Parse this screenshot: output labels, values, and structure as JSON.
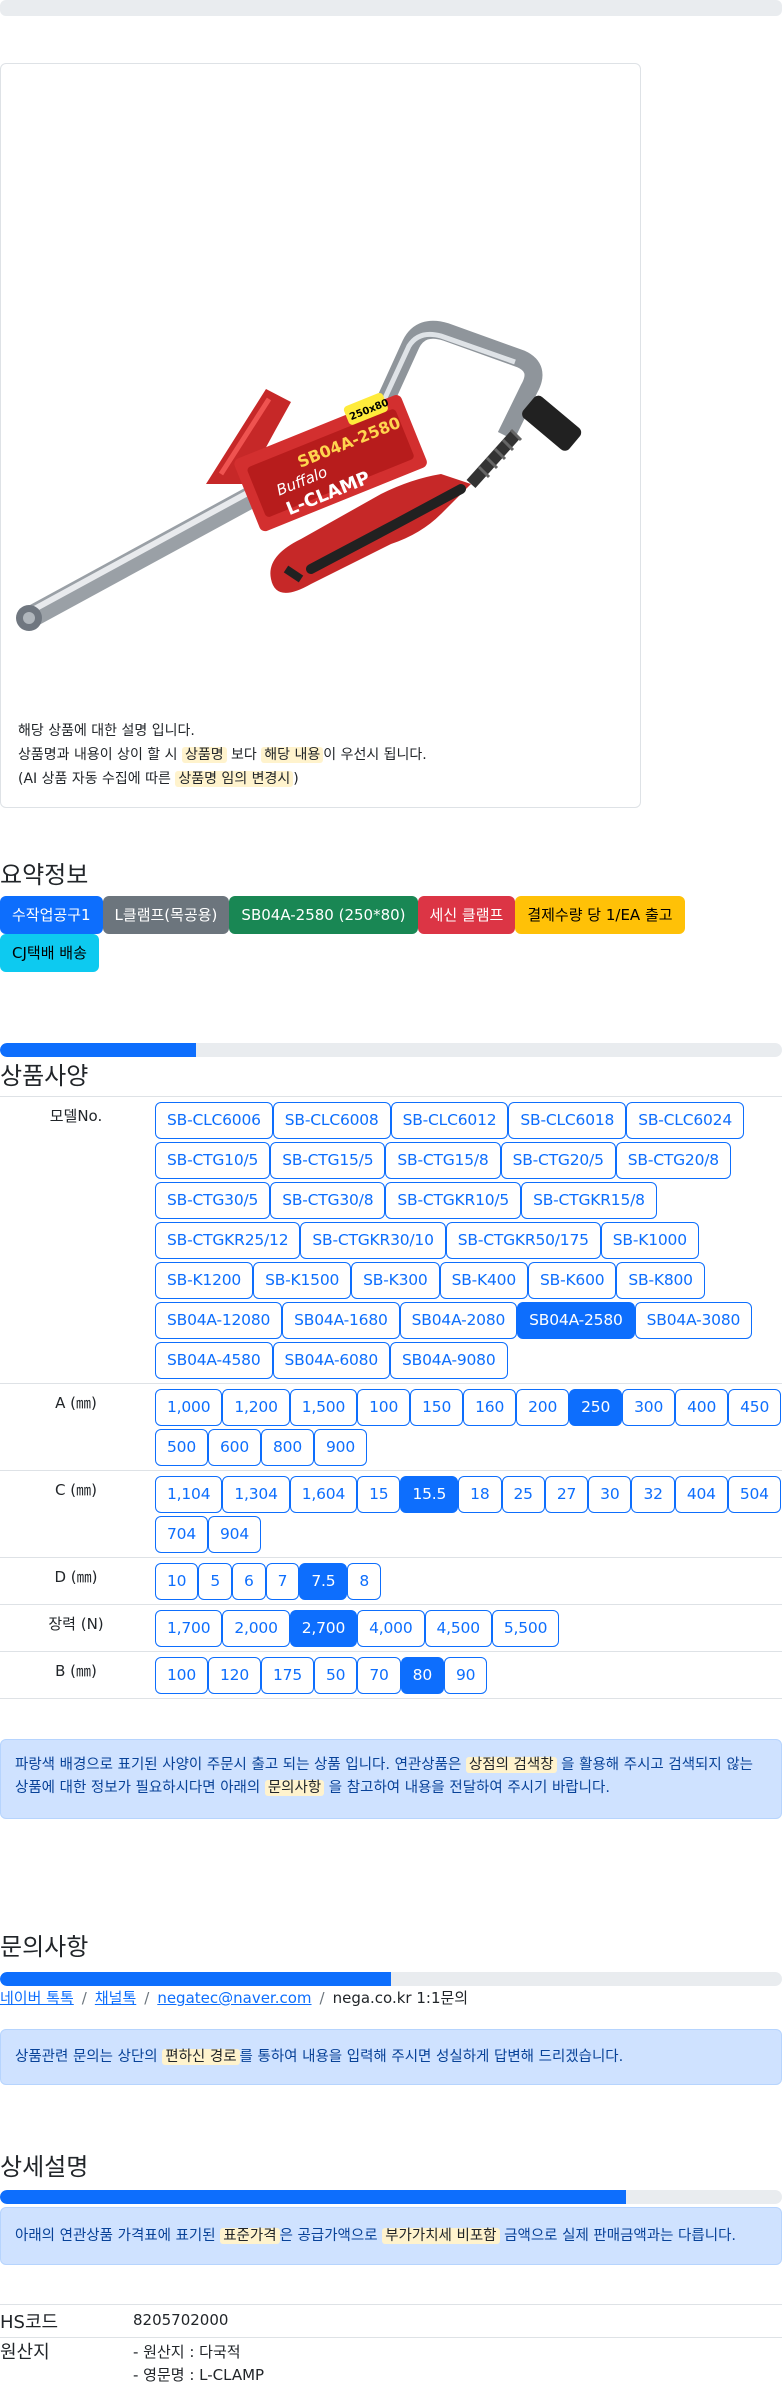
{
  "product": {
    "image_alt": "SB04A-2580 Buffalo L-CLAMP",
    "desc": {
      "line1": "해당 상품에 대한 설명 입니다.",
      "line2_a": "상품명과 내용이 상이 할 시 ",
      "line2_hl1": "상품명",
      "line2_b": " 보다 ",
      "line2_hl2": "해당 내용",
      "line2_c": "이 우선시 됩니다.",
      "line3_a": "(AI 상품 자동 수집에 따른 ",
      "line3_hl": "상품명 임의 변경시",
      "line3_b": ")"
    },
    "package_text": {
      "brand": "Buffalo",
      "model": "SB04A-2580",
      "name": "L-CLAMP",
      "size": "250x80"
    }
  },
  "summary": {
    "title": "요약정보",
    "badges": [
      {
        "label": "수작업공구1",
        "style": "b-primary"
      },
      {
        "label": "L클램프(목공용)",
        "style": "b-secondary"
      },
      {
        "label": "SB04A-2580 (250*80)",
        "style": "b-success"
      },
      {
        "label": "세신 클램프",
        "style": "b-danger"
      },
      {
        "label": "결제수량 당 1/EA 출고",
        "style": "b-warning"
      },
      {
        "label": "CJ택배 배송",
        "style": "b-info"
      }
    ]
  },
  "specs": {
    "title": "상품사양",
    "progress_fraction": 0.25,
    "rows": [
      {
        "label": "모델No.",
        "options": [
          "SB-CLC6006",
          "SB-CLC6008",
          "SB-CLC6012",
          "SB-CLC6018",
          "SB-CLC6024",
          "SB-CTG10/5",
          "SB-CTG15/5",
          "SB-CTG15/8",
          "SB-CTG20/5",
          "SB-CTG20/8",
          "SB-CTG30/5",
          "SB-CTG30/8",
          "SB-CTGKR10/5",
          "SB-CTGKR15/8",
          "SB-CTGKR25/12",
          "SB-CTGKR30/10",
          "SB-CTGKR50/175",
          "SB-K1000",
          "SB-K1200",
          "SB-K1500",
          "SB-K300",
          "SB-K400",
          "SB-K600",
          "SB-K800",
          "SB04A-12080",
          "SB04A-1680",
          "SB04A-2080",
          "SB04A-2580",
          "SB04A-3080",
          "SB04A-4580",
          "SB04A-6080",
          "SB04A-9080"
        ],
        "selected": "SB04A-2580"
      },
      {
        "label": "A (㎜)",
        "options": [
          "1,000",
          "1,200",
          "1,500",
          "100",
          "150",
          "160",
          "200",
          "250",
          "300",
          "400",
          "450",
          "500",
          "600",
          "800",
          "900"
        ],
        "selected": "250"
      },
      {
        "label": "C (㎜)",
        "options": [
          "1,104",
          "1,304",
          "1,604",
          "15",
          "15.5",
          "18",
          "25",
          "27",
          "30",
          "32",
          "404",
          "504",
          "704",
          "904"
        ],
        "selected": "15.5"
      },
      {
        "label": "D (㎜)",
        "options": [
          "10",
          "5",
          "6",
          "7",
          "7.5",
          "8"
        ],
        "selected": "7.5"
      },
      {
        "label": "장력 (N)",
        "options": [
          "1,700",
          "2,000",
          "2,700",
          "4,000",
          "4,500",
          "5,500"
        ],
        "selected": "2,700"
      },
      {
        "label": "B (㎜)",
        "options": [
          "100",
          "120",
          "175",
          "50",
          "70",
          "80",
          "90"
        ],
        "selected": "80"
      }
    ],
    "notice": {
      "a": "파랑색 배경으로 표기된 사양이 주문시 출고 되는 상품 입니다. 연관상품은 ",
      "hl1": "상점의 검색창",
      "b": " 을 활용해 주시고 검색되지 않는 상품에 대한 정보가 필요하시다면 아래의 ",
      "hl2": "문의사항",
      "c": " 을 참고하여 내용을 전달하여 주시기 바랍니다."
    }
  },
  "inquiry": {
    "title": "문의사항",
    "progress_fraction": 0.5,
    "links": [
      "네이버 톡톡",
      "채널톡",
      "negatec@naver.com"
    ],
    "plain": "nega.co.kr 1:1문의",
    "separator": "/",
    "notice": {
      "a": "상품관련 문의는 상단의 ",
      "hl": "편하신 경로",
      "b": "를 통하여 내용을 입력해 주시면 성실하게 답변해 드리겠습니다."
    }
  },
  "detail": {
    "title": "상세설명",
    "progress_fraction": 0.8,
    "notice": {
      "a": "아래의 연관상품 가격표에 표기된 ",
      "hl1": "표준가격",
      "b": "은 공급가액으로 ",
      "hl2": "부가가치세 비포함",
      "c": " 금액으로 실제 판매금액과는 다릅니다."
    },
    "hs_label": "HS코드",
    "hs_value": "8205702000",
    "origin_label": "원산지",
    "origin_lines": [
      "- 원산지 : 다국적",
      "- 영문명 : L-CLAMP"
    ]
  }
}
